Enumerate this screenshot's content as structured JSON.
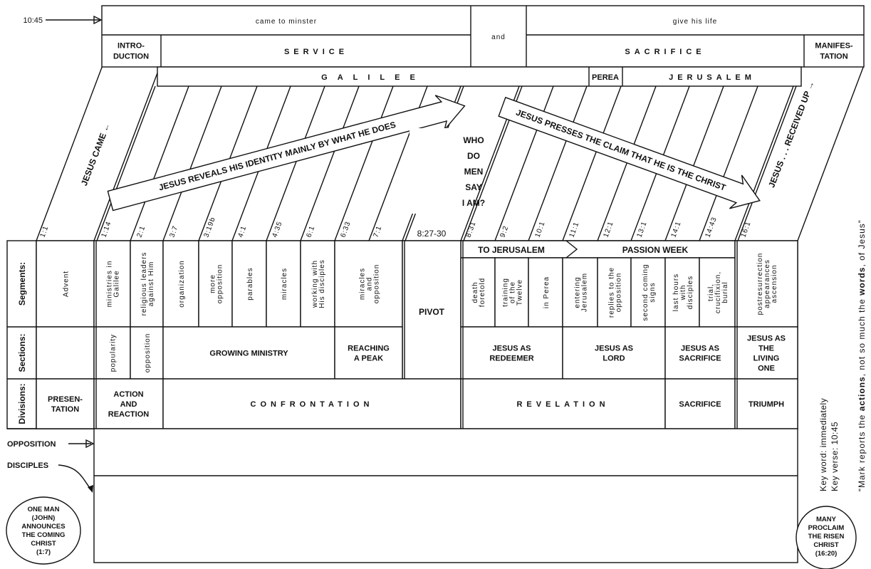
{
  "top": {
    "verse_ref": "10:45",
    "came": "came to minster",
    "and": "and",
    "give": "give his life",
    "intro": [
      "INTRO-",
      "DUCTION"
    ],
    "service": "SERVICE",
    "sacrifice": "SACRIFICE",
    "manifestation": [
      "MANIFES-",
      "TATION"
    ]
  },
  "regions": {
    "galilee": "GALILEE",
    "perea": "PEREA",
    "jerusalem": "JERUSALEM"
  },
  "diagonal": {
    "jesus_came": "JESUS CAME ←",
    "received_up": "JESUS . . . RECEIVED UP →",
    "arrow1": "JESUS REVEALS HIS IDENTITY MAINLY BY WHAT HE DOES",
    "arrow2": "JESUS PRESSES THE CLAIM THAT HE IS THE CHRIST",
    "question": [
      "WHO",
      "DO",
      "MEN",
      "SAY",
      "I AM?"
    ]
  },
  "references": [
    "1:1",
    "1:14",
    "2:1",
    "3:7",
    "3:19b",
    "4:1",
    "4:35",
    "6:1",
    "6:33",
    "7:1",
    "8:27-30",
    "8:31",
    "9:2",
    "10:1",
    "11:1",
    "12:1",
    "13:1",
    "14:1",
    "14:43",
    "16:1"
  ],
  "row_labels": {
    "segments": "Segments:",
    "sections": "Sections:",
    "divisions": "Divisions:"
  },
  "band": {
    "to_jerusalem": "TO JERUSALEM",
    "passion_week": "PASSION WEEK"
  },
  "segments": [
    [
      "Advent"
    ],
    [
      "ministries in",
      "Galilee"
    ],
    [
      "religious leaders",
      "against Him"
    ],
    [
      "organization"
    ],
    [
      "more",
      "opposition"
    ],
    [
      "parables"
    ],
    [
      "miracles"
    ],
    [
      "working with",
      "His disciples"
    ],
    [
      "miracles",
      "and",
      "opposition"
    ],
    [
      "PIVOT"
    ],
    [
      "death",
      "foretold"
    ],
    [
      "training",
      "of the",
      "Twelve"
    ],
    [
      "in Perea"
    ],
    [
      "entering",
      "Jerusalem"
    ],
    [
      "replies to the",
      "opposition"
    ],
    [
      "second coming",
      "signs"
    ],
    [
      "last hours",
      "with",
      "disciples"
    ],
    [
      "trial,",
      "crucifixion,",
      "burial"
    ],
    [
      "postresurrection",
      "appearances",
      "ascension"
    ]
  ],
  "sections": [
    [],
    [
      "popularity"
    ],
    [
      "opposition"
    ],
    [
      "GROWING MINISTRY"
    ],
    [
      "REACHING",
      "A PEAK"
    ],
    [
      "JESUS AS",
      "REDEEMER"
    ],
    [
      "JESUS AS",
      "LORD"
    ],
    [
      "JESUS AS",
      "SACRIFICE"
    ],
    [
      "JESUS AS",
      "THE",
      "LIVING",
      "ONE"
    ]
  ],
  "divisions": [
    [
      "PRESEN-",
      "TATION"
    ],
    [
      "ACTION",
      "AND",
      "REACTION"
    ],
    [
      "CONFRONTATION"
    ],
    [
      "REVELATION"
    ],
    [
      "SACRIFICE"
    ],
    [
      "TRIUMPH"
    ]
  ],
  "bottom": {
    "opposition": "OPPOSITION",
    "disciples": "DISCIPLES",
    "left_circle": [
      "ONE MAN",
      "(JOHN)",
      "ANNOUNCES",
      "THE COMING",
      "CHRIST",
      "(1:7)"
    ],
    "right_circle": [
      "MANY",
      "PROCLAIM",
      "THE RISEN",
      "CHRIST",
      "(16:20)"
    ]
  },
  "key": {
    "word": "Key word: immediately",
    "verse": "Key verse: 10:45",
    "quote": [
      "“Mark reports the ",
      "actions",
      ", not so much the ",
      "words",
      ", of Jesus”"
    ]
  }
}
